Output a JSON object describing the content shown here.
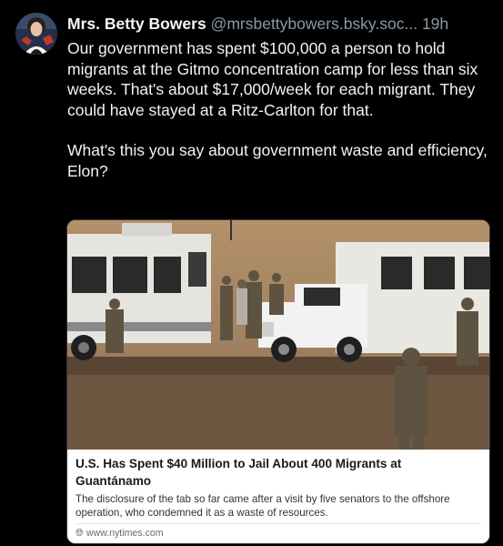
{
  "post": {
    "author_name": "Mrs. Betty Bowers",
    "handle": "@mrsbettybowers.bsky.soc...",
    "timestamp": "19h",
    "paragraphs": [
      "Our government has spent $100,000 a person to hold migrants at the Gitmo concentration camp for less than six weeks. That's about $17,000/week for each migrant. They could have stayed at a Ritz-Carlton for that.",
      "What's this you say about government waste and efficiency, Elon?"
    ],
    "avatar_icon": "profile-photo-icon"
  },
  "link_card": {
    "title": "U.S. Has Spent $40 Million to Jail About 400 Migrants at Guantánamo",
    "description": "The disclosure of the tab so far came after a visit by five senators to the offshore operation, who condemned it as a waste of resources.",
    "source": "www.nytimes.com",
    "source_icon": "globe-icon"
  }
}
